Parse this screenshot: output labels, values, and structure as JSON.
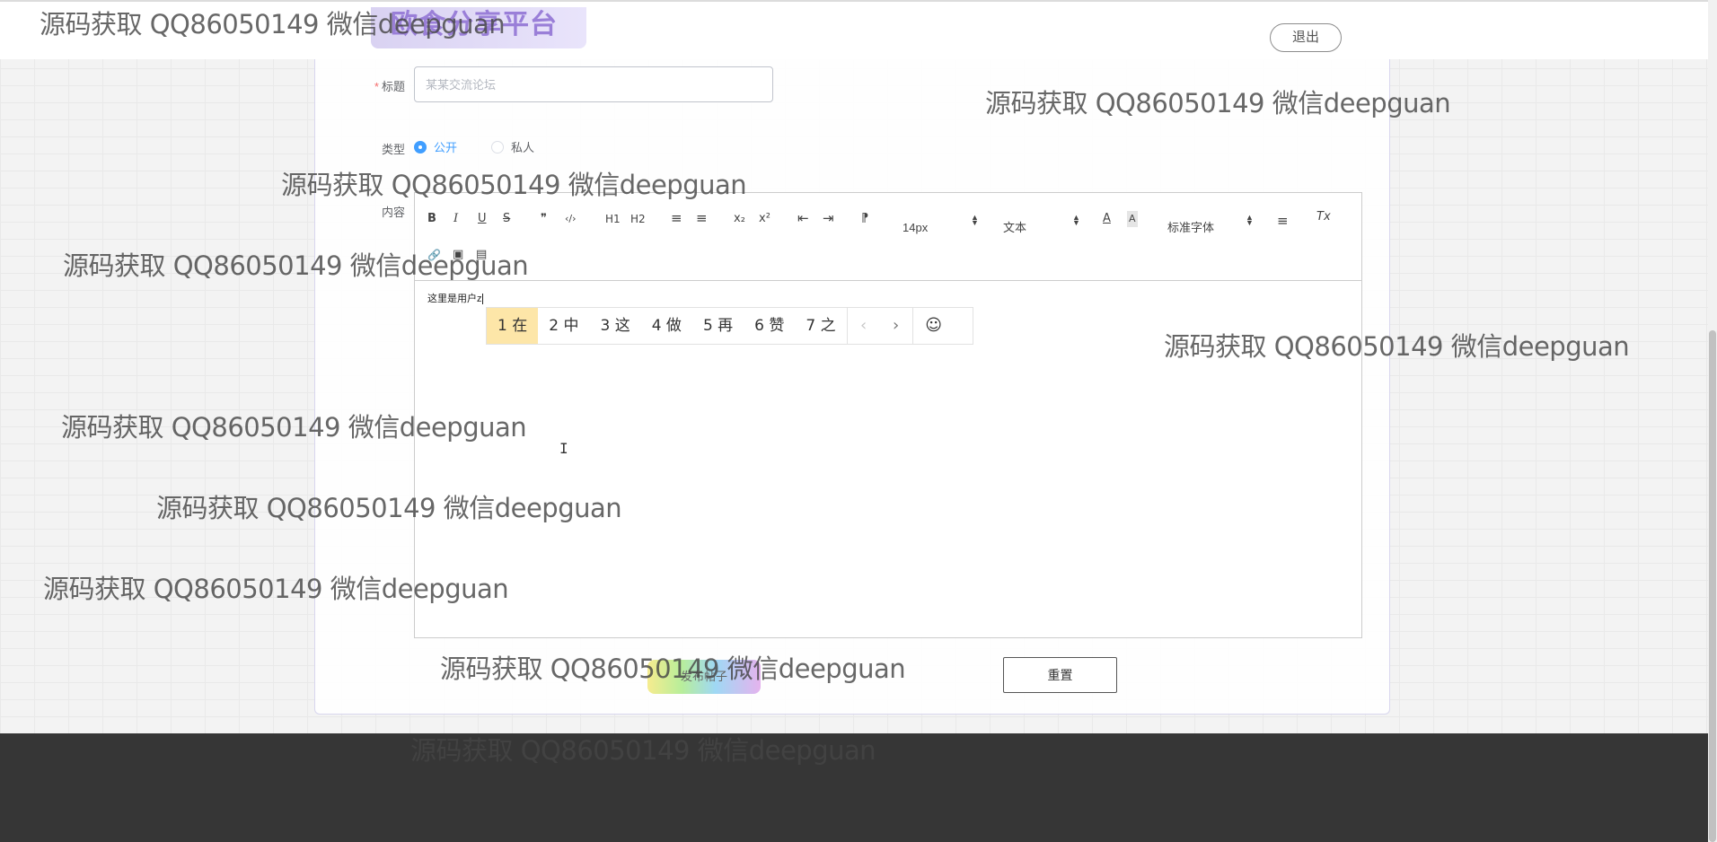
{
  "header": {
    "logo_text": "欧食分享平台",
    "logout_label": "退出"
  },
  "form": {
    "title_label": "标题",
    "title_placeholder": "某某交流论坛",
    "type_label": "类型",
    "type_options": [
      "公开",
      "私人"
    ],
    "type_selected": "公开",
    "content_label": "内容"
  },
  "editor": {
    "toolbar": {
      "bold": "B",
      "italic": "I",
      "underline": "U",
      "strike": "S",
      "blockquote": "❞",
      "code": "‹/›",
      "h1": "H1",
      "h2": "H2",
      "list_ordered": "≡",
      "list_bullet": "≡",
      "subscript": "x₂",
      "superscript": "x²",
      "outdent": "⇤",
      "indent": "⇥",
      "direction": "⁋",
      "size_value": "14px",
      "header_value": "文本",
      "color": "A",
      "background": "A",
      "font_value": "标准字体",
      "align": "≡",
      "clean": "Tx",
      "link": "🔗",
      "image": "▣",
      "video": "▤"
    },
    "content_text": "这里是用户z"
  },
  "ime": {
    "candidates": [
      "1 在",
      "2 中",
      "3 这",
      "4 做",
      "5 再",
      "6 赞",
      "7 之"
    ],
    "prev": "‹",
    "next": "›",
    "emoji": "☺"
  },
  "actions": {
    "submit_label": "发布帖子",
    "reset_label": "重置"
  },
  "watermark": {
    "text": "源码获取 QQ86050149 微信deepguan"
  }
}
